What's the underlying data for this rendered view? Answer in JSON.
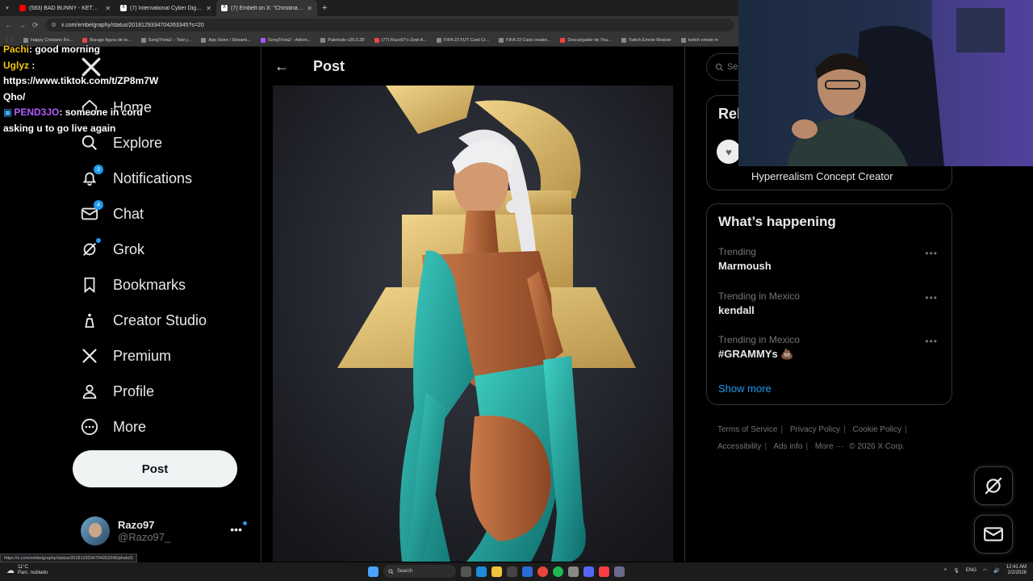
{
  "browser": {
    "tabs": [
      {
        "title": "(583) BAD BUNNY - KETU TeCh",
        "color": "#ff0000"
      },
      {
        "title": "(7) International Cyber Digest o",
        "color": "#ffffff"
      },
      {
        "title": "(7) Embelt on X: \"Christina Agui",
        "color": "#ffffff",
        "active": true
      }
    ],
    "new_tab": "+",
    "url": "x.com/embelgraphy/status/2018129334704263345?s=20",
    "bookmarks": [
      "Happy Cristiano Ro...",
      "Burago figura de to...",
      "SongTrivia2 – Test y...",
      "App Store / Streami...",
      "SongTrivia2 - Adivin...",
      "Paletools v26.0.28",
      "(77) Razo97's Zest-A...",
      "FIFA 23 FUT Card Cr...",
      "FIFA 23 Card creator...",
      "Descargador de You...",
      "Twitch Emote Resizer",
      "twitch emote m"
    ]
  },
  "chat_overlay": [
    {
      "user": "Pachi",
      "text": ": good morning"
    },
    {
      "user": "Uglyz",
      "text": " :"
    },
    {
      "text": "https://www.tiktok.com/t/ZP8m7W"
    },
    {
      "text": "Qho/"
    },
    {
      "user2": "PEND3JO",
      "text": ": someone in cord"
    },
    {
      "text": "asking u to go live again"
    }
  ],
  "nav": {
    "items": [
      {
        "label": "Home",
        "icon": "home-icon"
      },
      {
        "label": "Explore",
        "icon": "search-icon"
      },
      {
        "label": "Notifications",
        "icon": "bell-icon",
        "badge": "3"
      },
      {
        "label": "Chat",
        "icon": "mail-icon",
        "badge": "4"
      },
      {
        "label": "Grok",
        "icon": "grok-icon",
        "dot": true
      },
      {
        "label": "Bookmarks",
        "icon": "bookmark-icon"
      },
      {
        "label": "Creator Studio",
        "icon": "creator-studio-icon"
      },
      {
        "label": "Premium",
        "icon": "x-logo-icon"
      },
      {
        "label": "Profile",
        "icon": "person-icon"
      },
      {
        "label": "More",
        "icon": "more-circle-icon"
      }
    ],
    "post_button": "Post",
    "account": {
      "name": "Razo97",
      "handle": "@Razo97_",
      "more": "•••"
    }
  },
  "header": {
    "back": "←",
    "title": "Post"
  },
  "right": {
    "search_placeholder": "Se",
    "relevant_heading": "Rel",
    "relevant_bio": "Hyperrealism Concept Creator",
    "whats_happening": "What’s happening",
    "trends": [
      {
        "context": "Trending",
        "name": "Marmoush"
      },
      {
        "context": "Trending in Mexico",
        "name": "kendall"
      },
      {
        "context": "Trending in Mexico",
        "name": "#GRAMMYs 💩"
      }
    ],
    "trend_more": "•••",
    "show_more": "Show more",
    "footer": [
      "Terms of Service",
      "Privacy Policy",
      "Cookie Policy",
      "Accessibility",
      "Ads info",
      "More ···",
      "© 2026 X Corp."
    ]
  },
  "status_url": "https://x.com/embelgraphy/status/2018129334704263345/photo/1",
  "taskbar": {
    "weather_temp": "11°C",
    "weather_desc": "Parc. nublado",
    "search": "Search",
    "lang": "ENG",
    "time": "12:41 AM",
    "date": "2/2/2026"
  },
  "colors": {
    "accent": "#1d9bf0",
    "background": "#000000",
    "dress": "#1a9e96",
    "trophy": "#d8b96a"
  }
}
